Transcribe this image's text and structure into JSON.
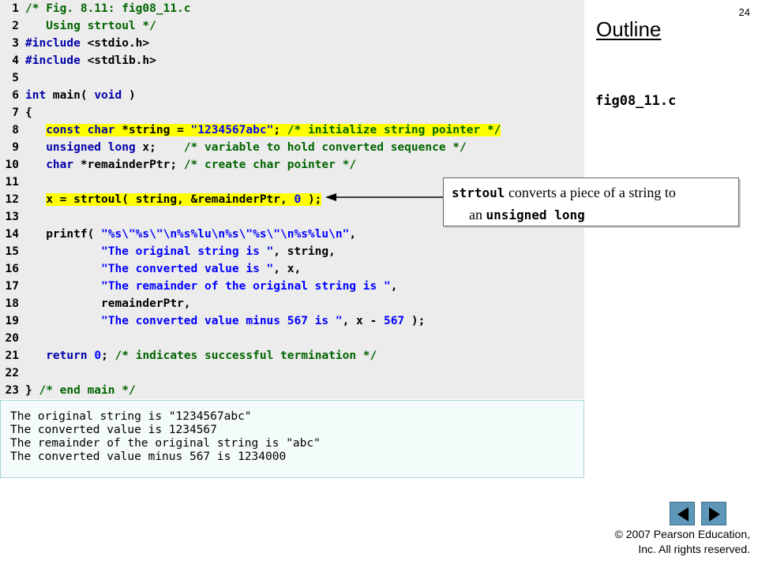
{
  "slide": {
    "number": "24",
    "outline_title": "Outline",
    "file_label": "fig08_11.c",
    "copyright_line1": "© 2007 Pearson Education,",
    "copyright_line2": "Inc.  All rights reserved."
  },
  "code_lines": [
    {
      "num": "1",
      "tokens": [
        {
          "t": "/* Fig. 8.11: fig08_11.c",
          "c": "cm"
        }
      ]
    },
    {
      "num": "2",
      "tokens": [
        {
          "t": "   Using strtoul */",
          "c": "cm"
        }
      ]
    },
    {
      "num": "3",
      "tokens": [
        {
          "t": "#include ",
          "c": "pp"
        },
        {
          "t": "<stdio.h>",
          "c": "id"
        }
      ]
    },
    {
      "num": "4",
      "tokens": [
        {
          "t": "#include ",
          "c": "pp"
        },
        {
          "t": "<stdlib.h>",
          "c": "id"
        }
      ]
    },
    {
      "num": "5",
      "tokens": []
    },
    {
      "num": "6",
      "tokens": [
        {
          "t": "int",
          "c": "kw"
        },
        {
          "t": " main( ",
          "c": "id"
        },
        {
          "t": "void",
          "c": "kw"
        },
        {
          "t": " )",
          "c": "id"
        }
      ]
    },
    {
      "num": "7",
      "tokens": [
        {
          "t": "{",
          "c": "id"
        }
      ]
    },
    {
      "num": "8",
      "hl": true,
      "tokens": [
        {
          "t": "   ",
          "c": "id",
          "nohl": true
        },
        {
          "t": "const char",
          "c": "kw"
        },
        {
          "t": " *string = ",
          "c": "id"
        },
        {
          "t": "\"1234567abc\"",
          "c": "st"
        },
        {
          "t": "; ",
          "c": "id"
        },
        {
          "t": "/* initialize string pointer */",
          "c": "cm"
        }
      ]
    },
    {
      "num": "9",
      "tokens": [
        {
          "t": "   ",
          "c": "id"
        },
        {
          "t": "unsigned long",
          "c": "kw"
        },
        {
          "t": " x;    ",
          "c": "id"
        },
        {
          "t": "/* variable to hold converted sequence */",
          "c": "cm"
        }
      ]
    },
    {
      "num": "10",
      "tokens": [
        {
          "t": "   ",
          "c": "id"
        },
        {
          "t": "char",
          "c": "kw"
        },
        {
          "t": " *remainderPtr; ",
          "c": "id"
        },
        {
          "t": "/* create char pointer */",
          "c": "cm"
        }
      ]
    },
    {
      "num": "11",
      "tokens": []
    },
    {
      "num": "12",
      "hl": true,
      "tokens": [
        {
          "t": "   ",
          "c": "id",
          "nohl": true
        },
        {
          "t": "x = strtoul( string, &remainderPtr, ",
          "c": "id"
        },
        {
          "t": "0",
          "c": "nm"
        },
        {
          "t": " );",
          "c": "id"
        }
      ]
    },
    {
      "num": "13",
      "tokens": []
    },
    {
      "num": "14",
      "tokens": [
        {
          "t": "   printf( ",
          "c": "id"
        },
        {
          "t": "\"%s\\\"%s\\\"\\n%s%lu\\n%s\\\"%s\\\"\\n%s%lu\\n\"",
          "c": "st"
        },
        {
          "t": ",",
          "c": "id"
        }
      ]
    },
    {
      "num": "15",
      "tokens": [
        {
          "t": "           ",
          "c": "id"
        },
        {
          "t": "\"The original string is \"",
          "c": "st"
        },
        {
          "t": ", string,",
          "c": "id"
        }
      ]
    },
    {
      "num": "16",
      "tokens": [
        {
          "t": "           ",
          "c": "id"
        },
        {
          "t": "\"The converted value is \"",
          "c": "st"
        },
        {
          "t": ", x,",
          "c": "id"
        }
      ]
    },
    {
      "num": "17",
      "tokens": [
        {
          "t": "           ",
          "c": "id"
        },
        {
          "t": "\"The remainder of the original string is \"",
          "c": "st"
        },
        {
          "t": ",",
          "c": "id"
        }
      ]
    },
    {
      "num": "18",
      "tokens": [
        {
          "t": "           remainderPtr,",
          "c": "id"
        }
      ]
    },
    {
      "num": "19",
      "tokens": [
        {
          "t": "           ",
          "c": "id"
        },
        {
          "t": "\"The converted value minus 567 is \"",
          "c": "st"
        },
        {
          "t": ", x - ",
          "c": "id"
        },
        {
          "t": "567",
          "c": "nm"
        },
        {
          "t": " );",
          "c": "id"
        }
      ]
    },
    {
      "num": "20",
      "tokens": []
    },
    {
      "num": "21",
      "tokens": [
        {
          "t": "   ",
          "c": "id"
        },
        {
          "t": "return",
          "c": "kw"
        },
        {
          "t": " ",
          "c": "id"
        },
        {
          "t": "0",
          "c": "nm"
        },
        {
          "t": "; ",
          "c": "id"
        },
        {
          "t": "/* indicates successful termination */",
          "c": "cm"
        }
      ]
    },
    {
      "num": "22",
      "tokens": []
    },
    {
      "num": "23",
      "tokens": [
        {
          "t": "} ",
          "c": "id"
        },
        {
          "t": "/* end main */",
          "c": "cm"
        }
      ]
    }
  ],
  "output_lines": [
    "The original string is \"1234567abc\"",
    "The converted value is 1234567",
    "The remainder of the original string is \"abc\"",
    "The converted value minus 567 is 1234000"
  ],
  "callout": {
    "code1": "strtoul",
    "text1": " converts a piece of a string to",
    "text2": "an ",
    "code2": "unsigned long"
  },
  "colors": {
    "code_background": "#ececec",
    "highlight": "#ffff00",
    "comment": "#006400",
    "keyword": "#0000aa",
    "string": "#0000ff",
    "nav_button": "#5f97b9"
  },
  "icons": {
    "prev": "triangle-left-icon",
    "next": "triangle-right-icon"
  }
}
